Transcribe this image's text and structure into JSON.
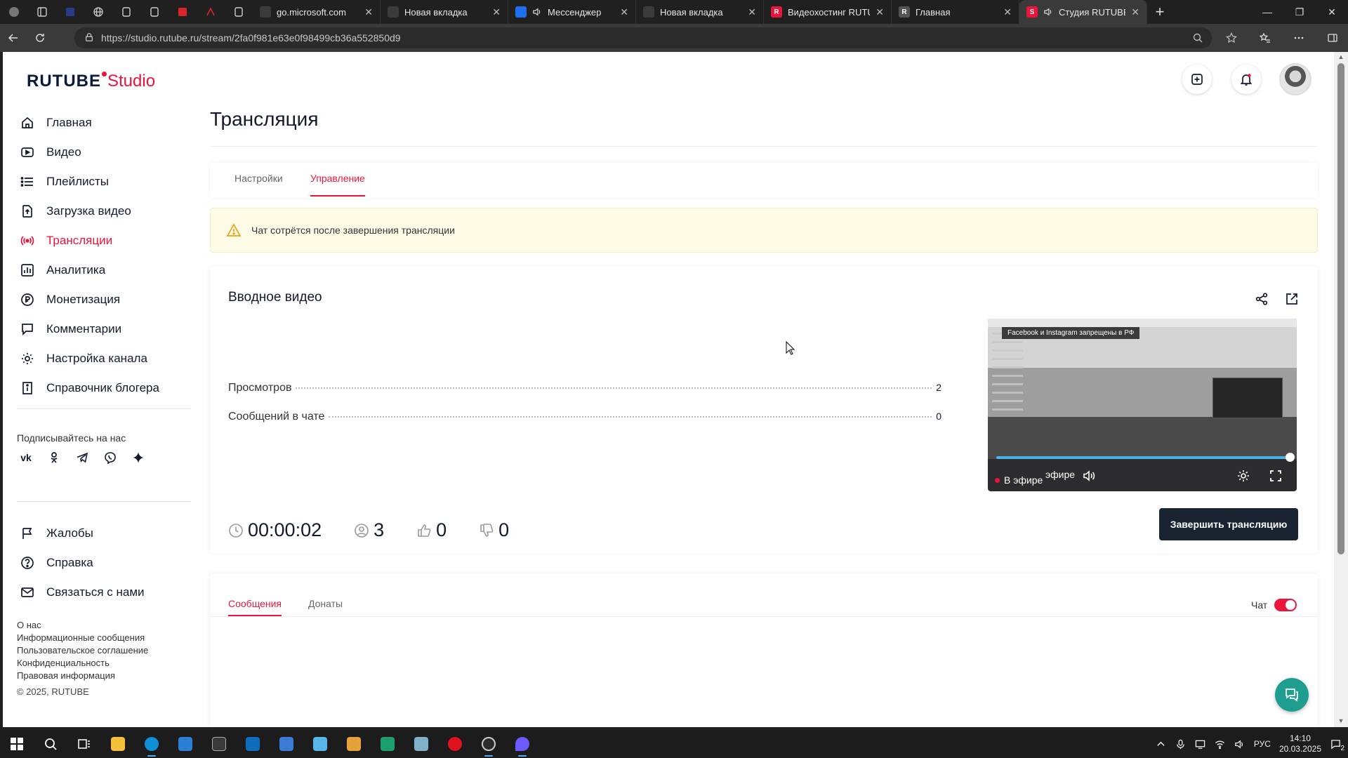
{
  "browser": {
    "tabs": [
      {
        "label": "go.microsoft.com",
        "fav_color": "#3b3b3b",
        "fav_letter": ""
      },
      {
        "label": "Новая вкладка",
        "fav_color": "#3b3b3b",
        "fav_letter": ""
      },
      {
        "label": "Мессенджер",
        "fav_color": "#1e6ff0",
        "fav_letter": ""
      },
      {
        "label": "Новая вкладка",
        "fav_color": "#3b3b3b",
        "fav_letter": ""
      },
      {
        "label": "Видеохостинг RUTUBE",
        "fav_color": "#ed143b",
        "fav_letter": "R"
      },
      {
        "label": "Главная",
        "fav_color": "#555555",
        "fav_letter": "R"
      },
      {
        "label": "Студия RUTUBE",
        "fav_color": "#ed143b",
        "fav_letter": "S"
      }
    ],
    "url": "https://studio.rutube.ru/stream/2fa0f981e63e0f98499cb36a552850d9"
  },
  "logo": {
    "brand": "RUTUBE",
    "suffix": "Studio"
  },
  "sidebar": {
    "items": [
      {
        "label": "Главная",
        "icon": "home-icon"
      },
      {
        "label": "Видео",
        "icon": "video-icon"
      },
      {
        "label": "Плейлисты",
        "icon": "playlist-icon"
      },
      {
        "label": "Загрузка видео",
        "icon": "upload-icon"
      },
      {
        "label": "Трансляции",
        "icon": "broadcast-icon"
      },
      {
        "label": "Аналитика",
        "icon": "analytics-icon"
      },
      {
        "label": "Монетизация",
        "icon": "ruble-icon"
      },
      {
        "label": "Комментарии",
        "icon": "comment-icon"
      },
      {
        "label": "Настройка канала",
        "icon": "gear-icon"
      },
      {
        "label": "Справочник блогера",
        "icon": "info-icon"
      }
    ],
    "follow_title": "Подписывайтесь на нас",
    "socials": [
      "vk-icon",
      "ok-icon",
      "telegram-icon",
      "viber-icon",
      "zen-icon"
    ],
    "secondary": [
      {
        "label": "Жалобы",
        "icon": "flag-icon"
      },
      {
        "label": "Справка",
        "icon": "help-icon"
      },
      {
        "label": "Связаться с нами",
        "icon": "mail-icon"
      }
    ],
    "footer_links": [
      "О нас",
      "Информационные сообщения",
      "Пользовательское соглашение",
      "Конфиденциальность",
      "Правовая информация"
    ],
    "copyright": "© 2025, RUTUBE"
  },
  "header": {
    "title": "Трансляция"
  },
  "tabs": {
    "settings": "Настройки",
    "control": "Управление"
  },
  "warning": {
    "text": "Чат сотрётся после завершения трансляции"
  },
  "stream": {
    "title": "Вводное видео",
    "stats": [
      {
        "label": "Просмотров",
        "value": "2"
      },
      {
        "label": "Сообщений в чате",
        "value": "0"
      }
    ],
    "player": {
      "banner": "Facebook и Instagram запрещены в РФ",
      "live_label": "В эфире",
      "live_label_overlap": "эфире",
      "progress": 1.0
    },
    "metrics": {
      "duration": "00:00:02",
      "viewers": "3",
      "likes": "0",
      "dislikes": "0"
    },
    "end_button": "Завершить трансляцию"
  },
  "chat": {
    "tabs": {
      "messages": "Сообщения",
      "donations": "Донаты"
    },
    "toggle_label": "Чат",
    "enabled": true
  },
  "taskbar": {
    "language": "РУС",
    "time": "14:10",
    "date": "20.03.2025",
    "notifications": "2"
  },
  "colors": {
    "accent": "#ed143b",
    "dark": "#131a2e",
    "button": "#1a2332",
    "warn_bg": "#fefbe6"
  }
}
